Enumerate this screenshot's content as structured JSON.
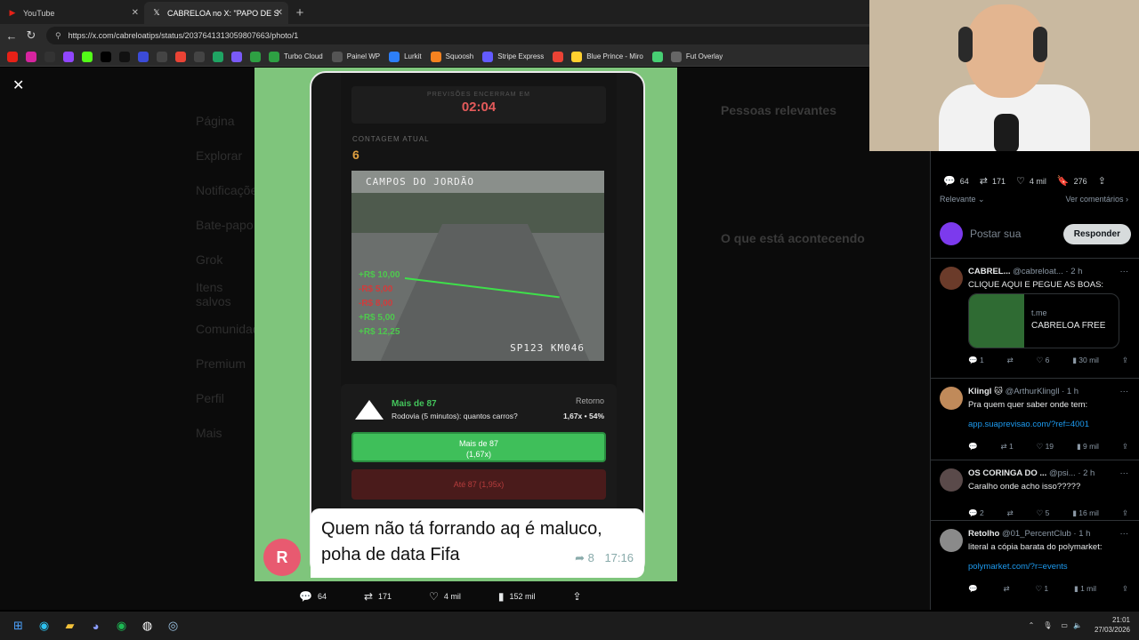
{
  "browser": {
    "tabs": [
      {
        "label": "YouTube",
        "icon": "youtube-icon",
        "active": false
      },
      {
        "label": "CABRELOA no X: \"PAPO DE SE TRA",
        "icon": "x-icon",
        "active": true
      }
    ],
    "url": "https://x.com/cabreloatips/status/2037641313059807663/photo/1",
    "bookmarks": [
      {
        "label": "",
        "icon": "youtube-icon",
        "color": "#e62117"
      },
      {
        "label": "",
        "icon": "instagram-icon",
        "color": "#d6249f"
      },
      {
        "label": "",
        "icon": "amazon-icon",
        "color": "#333333"
      },
      {
        "label": "",
        "icon": "twitch-icon",
        "color": "#9146ff"
      },
      {
        "label": "",
        "icon": "kick-icon",
        "color": "#53fc18"
      },
      {
        "label": "",
        "icon": "x-icon",
        "color": "#000000"
      },
      {
        "label": "",
        "icon": "tiktok-icon",
        "color": "#111111"
      },
      {
        "label": "",
        "icon": "app-icon",
        "color": "#3b4bd8"
      },
      {
        "label": "",
        "icon": "chatgpt-icon",
        "color": "#444444"
      },
      {
        "label": "",
        "icon": "gmail-icon",
        "color": "#ea4335"
      },
      {
        "label": "",
        "icon": "notion-icon",
        "color": "#444444"
      },
      {
        "label": "",
        "icon": "drive-icon",
        "color": "#1fa463"
      },
      {
        "label": "",
        "icon": "sl-icon",
        "color": "#7a5af8"
      },
      {
        "label": "",
        "icon": "refresh-app-icon",
        "color": "#2ea043"
      },
      {
        "label": "Turbo Cloud",
        "icon": "cloud-icon",
        "color": "#2ea043"
      },
      {
        "label": "Painel WP",
        "icon": "folder-icon",
        "color": "#555555"
      },
      {
        "label": "Lurkit",
        "icon": "lurkit-icon",
        "color": "#2d7ff9"
      },
      {
        "label": "Squoosh",
        "icon": "squoosh-icon",
        "color": "#f58220"
      },
      {
        "label": "Stripe Express",
        "icon": "stripe-icon",
        "color": "#635bff"
      },
      {
        "label": "",
        "icon": "maps-pin-icon",
        "color": "#ea4335"
      },
      {
        "label": "Blue Prince - Miro",
        "icon": "miro-icon",
        "color": "#ffd02f"
      },
      {
        "label": "",
        "icon": "codepen-icon",
        "color": "#47cf73"
      },
      {
        "label": "Fut Overlay",
        "icon": "globe-icon",
        "color": "#666666"
      }
    ]
  },
  "screenshot": {
    "timer_label": "PREVISÕES ENCERRAM EM",
    "timer": "02:04",
    "count_label": "CONTAGEM ATUAL",
    "count": "6",
    "cam_title": "CAMPOS DO JORDÃO",
    "cam_footer": "SP123 KM046",
    "bonuses": [
      {
        "text": "+R$ 10,00",
        "color": "#4ec94e"
      },
      {
        "text": "-R$ 5,00",
        "color": "#d23b3b"
      },
      {
        "text": "-R$ 8,00",
        "color": "#d23b3b"
      },
      {
        "text": "+R$ 5,00",
        "color": "#4ec94e"
      },
      {
        "text": "+R$ 12,25",
        "color": "#4ec94e"
      }
    ],
    "bet_title": "Mais de 87",
    "bet_sub": "Rodovia (5 minutos): quantos carros?",
    "bet_return_label": "Retorno",
    "bet_odds": "1,67x • 54%",
    "btn_green_line1": "Mais de 87",
    "btn_green_line2": "(1,67x)",
    "btn_red": "Até 87 (1,95x)",
    "message": "Quem não tá forrando aq é maluco, poha de data Fifa",
    "message_reply_count": "8",
    "message_time": "17:16",
    "avatar_letter": "R"
  },
  "photo_actions": {
    "replies": "64",
    "reposts": "171",
    "likes": "4 mil",
    "views": "152 mil"
  },
  "side": {
    "stats": {
      "replies": "64",
      "reposts": "171",
      "likes": "4 mil",
      "bookmarks": "276"
    },
    "sort_label": "Relevante",
    "see_comments": "Ver comentários",
    "reply_placeholder": "Postar sua",
    "reply_button": "Responder",
    "comments": [
      {
        "name": "CABREL...",
        "handle": "@cabreloat... · 2 h",
        "text": "CLIQUE AQUI E PEGUE AS BOAS:",
        "link": "",
        "card_domain": "t.me",
        "card_title": "CABRELOA FREE",
        "replies": "1",
        "reposts": "",
        "likes": "6",
        "views": "30 mil",
        "avatar_color": "#6b3b2a"
      },
      {
        "name": "Klingl 🐱",
        "handle": "@ArthurKlingll · 1 h",
        "text": "Pra quem quer saber onde tem:",
        "link": "app.suaprevisao.com/?ref=4001",
        "replies": "",
        "reposts": "1",
        "likes": "19",
        "views": "9 mil",
        "avatar_color": "#c08a5a"
      },
      {
        "name": "OS CORINGA DO ...",
        "handle": "@psi... · 2 h",
        "text": "Caralho onde acho isso?????",
        "link": "",
        "replies": "2",
        "reposts": "",
        "likes": "5",
        "views": "16 mil",
        "avatar_color": "#5a4a4a"
      },
      {
        "name": "Retolho",
        "handle": "@01_PercentClub · 1 h",
        "text": "literal a cópia barata do polymarket:",
        "link": "polymarket.com/?r=events",
        "replies": "",
        "reposts": "",
        "likes": "1",
        "views": "1 mil",
        "avatar_color": "#8a8a8a"
      }
    ]
  },
  "background_nav": [
    "Página",
    "Explorar",
    "Notificações",
    "Bate-papo",
    "Grok",
    "Itens salvos",
    "Comunidades",
    "Premium",
    "Perfil",
    "Mais"
  ],
  "right_dim": {
    "heading_people": "Pessoas relevantes",
    "heading_trends": "O que está acontecendo"
  },
  "taskbar": {
    "time": "21:01",
    "date": "27/03/2026"
  }
}
